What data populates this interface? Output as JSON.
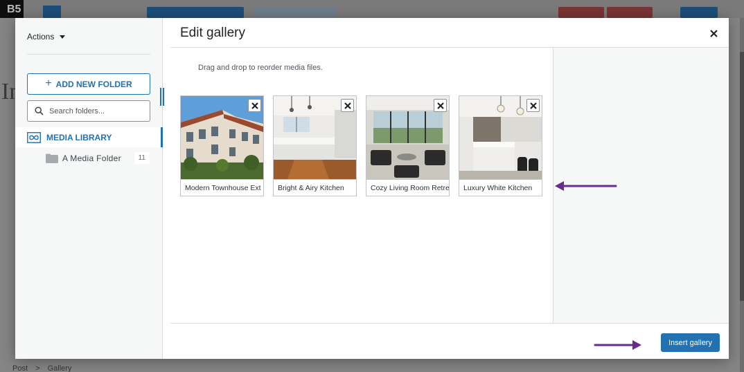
{
  "editor": {
    "logo": "B5",
    "breadcrumb": [
      "Post",
      ">",
      "Gallery"
    ],
    "big_text": "In"
  },
  "sidebar": {
    "actions_label": "Actions",
    "add_folder_label": "ADD NEW FOLDER",
    "search_placeholder": "Search folders...",
    "media_library_label": "MEDIA LIBRARY",
    "folders": [
      {
        "label": "A Media Folder",
        "count": "11"
      }
    ]
  },
  "modal": {
    "title": "Edit gallery",
    "drag_hint": "Drag and drop to reorder media files.",
    "insert_label": "Insert gallery"
  },
  "gallery": [
    {
      "caption": "Modern Townhouse Ext"
    },
    {
      "caption": "Bright & Airy Kitchen"
    },
    {
      "caption": "Cozy Living Room Retre"
    },
    {
      "caption": "Luxury White Kitchen"
    }
  ],
  "colors": {
    "accent": "#2271b1",
    "annotation": "#6a2a8f"
  },
  "icons": {
    "close": "close-icon",
    "remove": "remove-icon",
    "folder": "folder-icon",
    "search": "search-icon",
    "media_library": "media-library-icon"
  }
}
